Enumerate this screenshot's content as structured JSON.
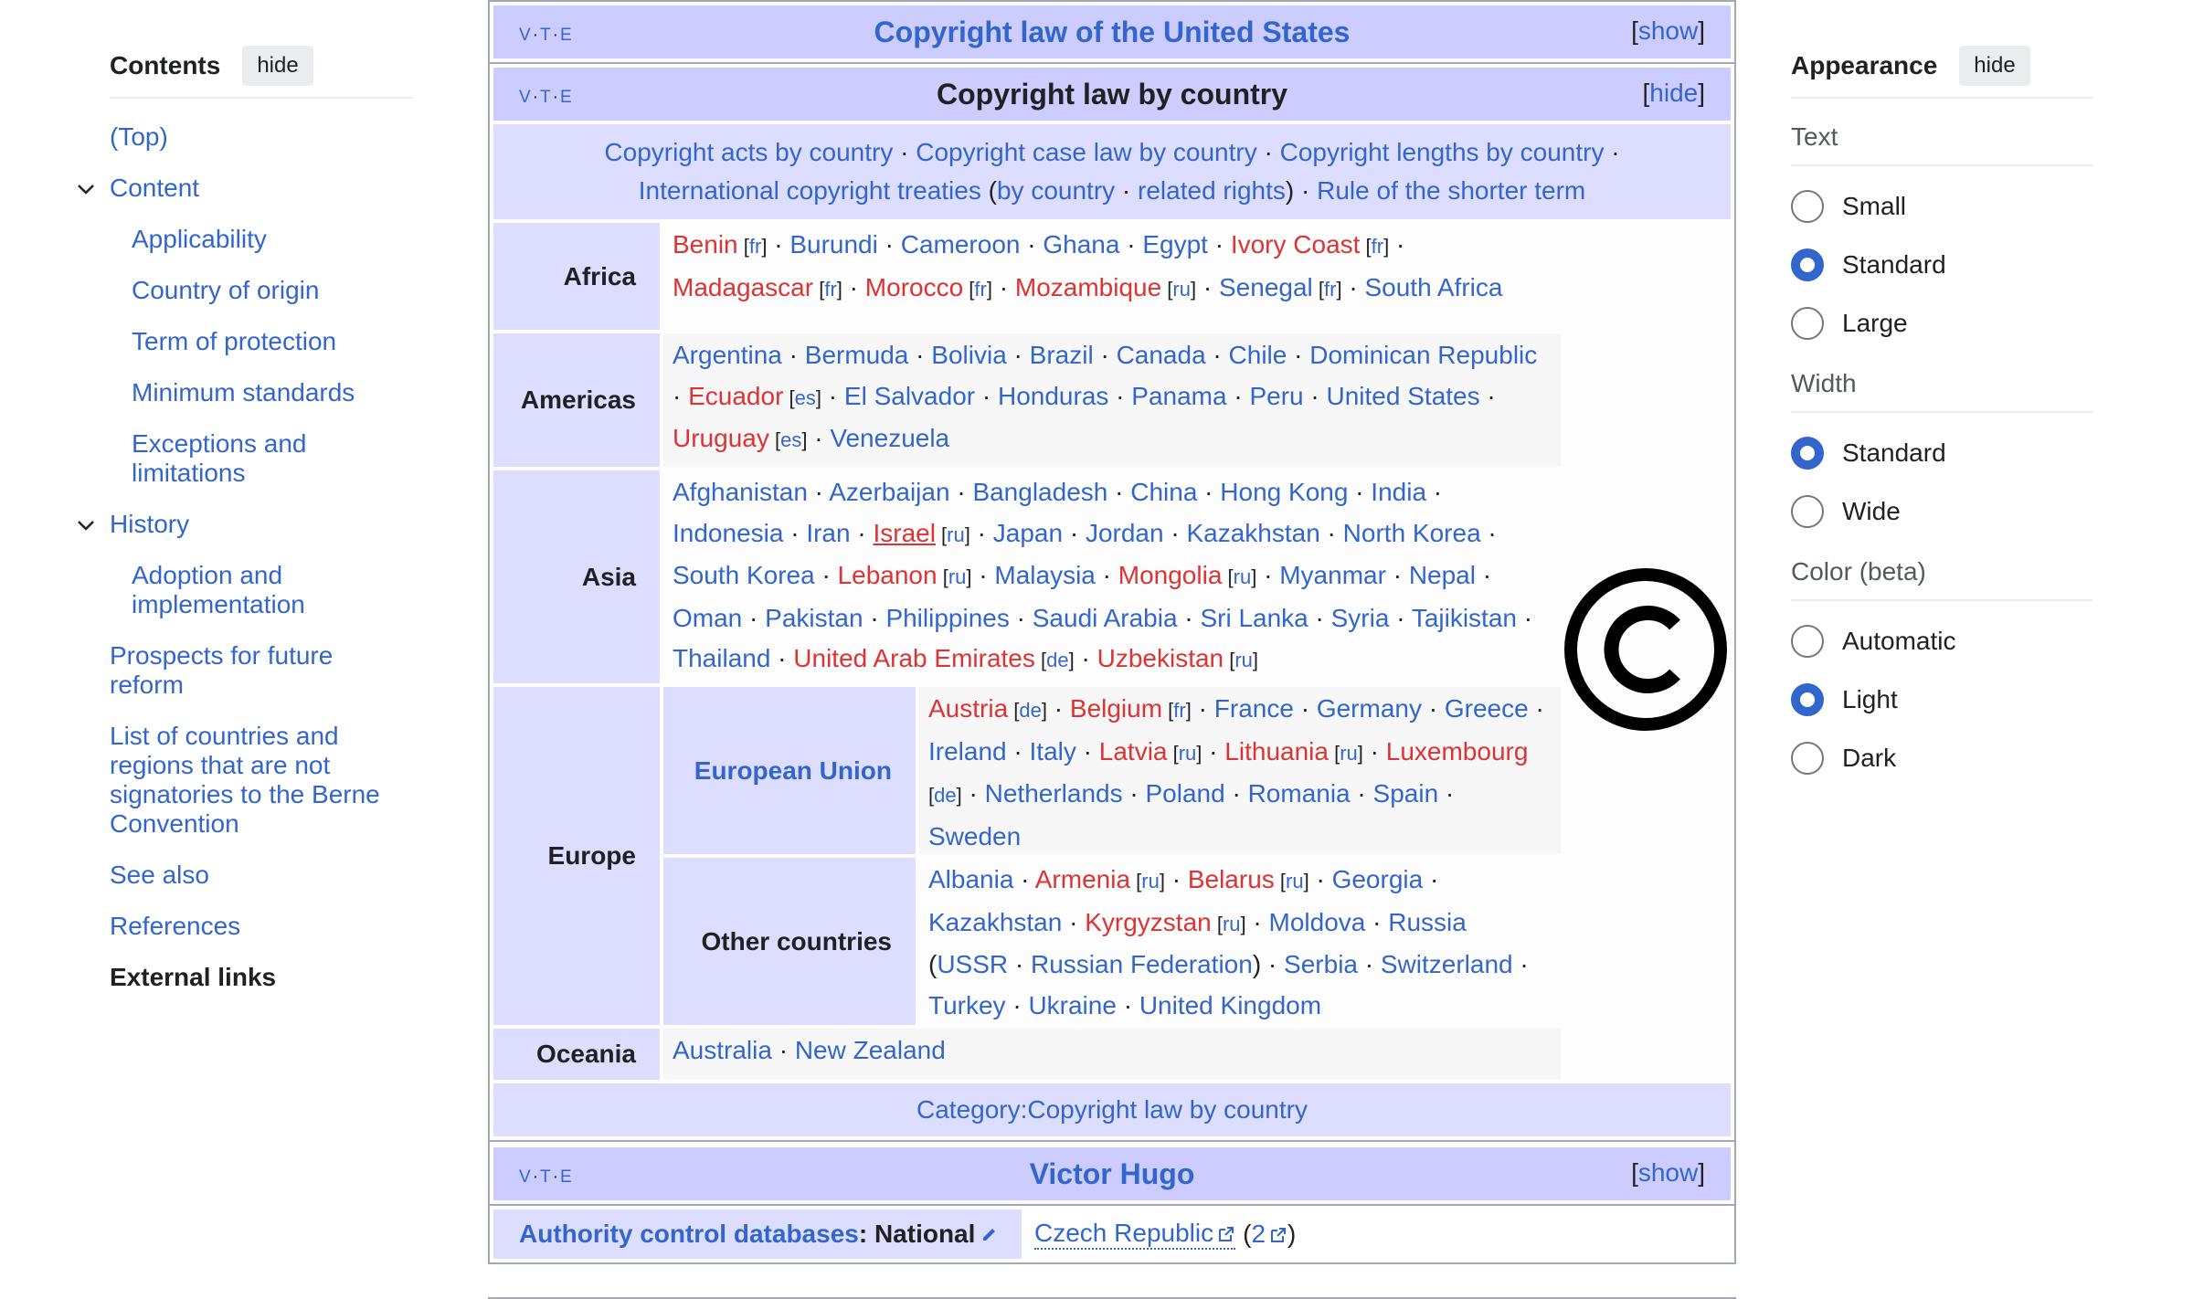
{
  "toc": {
    "title": "Contents",
    "hide_label": "hide",
    "items": [
      {
        "label": "(Top)",
        "level": 1
      },
      {
        "label": "Content",
        "level": 1,
        "expanded": true
      },
      {
        "label": "Applicability",
        "level": 2
      },
      {
        "label": "Country of origin",
        "level": 2
      },
      {
        "label": "Term of protection",
        "level": 2
      },
      {
        "label": "Minimum standards",
        "level": 2
      },
      {
        "label": "Exceptions and limitations",
        "level": 2
      },
      {
        "label": "History",
        "level": 1,
        "expanded": true
      },
      {
        "label": "Adoption and implementation",
        "level": 2
      },
      {
        "label": "Prospects for future reform",
        "level": 1
      },
      {
        "label": "List of countries and regions that are not signatories to the Berne Convention",
        "level": 1
      },
      {
        "label": "See also",
        "level": 1
      },
      {
        "label": "References",
        "level": 1
      },
      {
        "label": "External links",
        "level": 1,
        "active": true
      }
    ]
  },
  "appearance": {
    "title": "Appearance",
    "hide_label": "hide",
    "text_heading": "Text",
    "text_options": [
      "Small",
      "Standard",
      "Large"
    ],
    "text_selected": "Standard",
    "width_heading": "Width",
    "width_options": [
      "Standard",
      "Wide"
    ],
    "width_selected": "Standard",
    "color_heading": "Color (beta)",
    "color_options": [
      "Automatic",
      "Light",
      "Dark"
    ],
    "color_selected": "Light"
  },
  "navbox_top": {
    "vte": [
      "V",
      "T",
      "E"
    ],
    "title": "Copyright law of the United States",
    "toggle": "show"
  },
  "navbox_main": {
    "vte": [
      "V",
      "T",
      "E"
    ],
    "title": "Copyright law by country",
    "toggle": "hide",
    "above": {
      "acts": "Copyright acts by country",
      "case_law": "Copyright case law by country",
      "lengths": "Copyright lengths by country",
      "treaties": "International copyright treaties",
      "by_country": "by country",
      "related": "related rights",
      "shorter": "Rule of the shorter term"
    },
    "groups": {
      "africa": {
        "label": "Africa",
        "items": [
          {
            "name": "Benin",
            "red": true,
            "lang": "fr"
          },
          {
            "name": "Burundi"
          },
          {
            "name": "Cameroon"
          },
          {
            "name": "Ghana"
          },
          {
            "name": "Egypt"
          },
          {
            "name": "Ivory Coast",
            "red": true,
            "lang": "fr"
          },
          {
            "name": "Madagascar",
            "red": true,
            "lang": "fr"
          },
          {
            "name": "Morocco",
            "red": true,
            "lang": "fr"
          },
          {
            "name": "Mozambique",
            "red": true,
            "lang": "ru"
          },
          {
            "name": "Senegal",
            "lang": "fr"
          },
          {
            "name": "South Africa"
          }
        ]
      },
      "americas": {
        "label": "Americas",
        "items": [
          {
            "name": "Argentina"
          },
          {
            "name": "Bermuda"
          },
          {
            "name": "Bolivia"
          },
          {
            "name": "Brazil"
          },
          {
            "name": "Canada"
          },
          {
            "name": "Chile"
          },
          {
            "name": "Dominican Republic"
          },
          {
            "name": "Ecuador",
            "red": true,
            "lang": "es"
          },
          {
            "name": "El Salvador"
          },
          {
            "name": "Honduras"
          },
          {
            "name": "Panama"
          },
          {
            "name": "Peru"
          },
          {
            "name": "United States"
          },
          {
            "name": "Uruguay",
            "red": true,
            "lang": "es"
          },
          {
            "name": "Venezuela"
          }
        ]
      },
      "asia": {
        "label": "Asia",
        "items": [
          {
            "name": "Afghanistan"
          },
          {
            "name": "Azerbaijan"
          },
          {
            "name": "Bangladesh"
          },
          {
            "name": "China"
          },
          {
            "name": "Hong Kong"
          },
          {
            "name": "India"
          },
          {
            "name": "Indonesia"
          },
          {
            "name": "Iran"
          },
          {
            "name": "Israel",
            "red": true,
            "underline": true,
            "lang": "ru"
          },
          {
            "name": "Japan"
          },
          {
            "name": "Jordan"
          },
          {
            "name": "Kazakhstan"
          },
          {
            "name": "North Korea"
          },
          {
            "name": "South Korea"
          },
          {
            "name": "Lebanon",
            "red": true,
            "lang": "ru"
          },
          {
            "name": "Malaysia"
          },
          {
            "name": "Mongolia",
            "red": true,
            "lang": "ru"
          },
          {
            "name": "Myanmar"
          },
          {
            "name": "Nepal"
          },
          {
            "name": "Oman"
          },
          {
            "name": "Pakistan"
          },
          {
            "name": "Philippines"
          },
          {
            "name": "Saudi Arabia"
          },
          {
            "name": "Sri Lanka"
          },
          {
            "name": "Syria"
          },
          {
            "name": "Tajikistan"
          },
          {
            "name": "Thailand"
          },
          {
            "name": "United Arab Emirates",
            "red": true,
            "lang": "de"
          },
          {
            "name": "Uzbekistan",
            "red": true,
            "lang": "ru"
          }
        ]
      },
      "europe": {
        "label": "Europe",
        "eu": {
          "label": "European Union",
          "items": [
            {
              "name": "Austria",
              "red": true,
              "lang": "de"
            },
            {
              "name": "Belgium",
              "red": true,
              "lang": "fr"
            },
            {
              "name": "France"
            },
            {
              "name": "Germany"
            },
            {
              "name": "Greece"
            },
            {
              "name": "Ireland"
            },
            {
              "name": "Italy"
            },
            {
              "name": "Latvia",
              "red": true,
              "lang": "ru"
            },
            {
              "name": "Lithuania",
              "red": true,
              "lang": "ru"
            },
            {
              "name": "Luxembourg",
              "red": true,
              "lang": "de"
            },
            {
              "name": "Netherlands"
            },
            {
              "name": "Poland"
            },
            {
              "name": "Romania"
            },
            {
              "name": "Spain"
            },
            {
              "name": "Sweden"
            }
          ]
        },
        "other": {
          "label": "Other countries",
          "items": [
            {
              "name": "Albania"
            },
            {
              "name": "Armenia",
              "red": true,
              "lang": "ru"
            },
            {
              "name": "Belarus",
              "red": true,
              "lang": "ru"
            },
            {
              "name": "Georgia"
            },
            {
              "name": "Kazakhstan"
            },
            {
              "name": "Kyrgyzstan",
              "red": true,
              "lang": "ru"
            },
            {
              "name": "Moldova"
            },
            {
              "name": "Russia",
              "children": [
                "USSR",
                "Russian Federation"
              ]
            },
            {
              "name": "Serbia"
            },
            {
              "name": "Switzerland"
            },
            {
              "name": "Turkey"
            },
            {
              "name": "Ukraine"
            },
            {
              "name": "United Kingdom"
            }
          ]
        }
      },
      "oceania": {
        "label": "Oceania",
        "items": [
          {
            "name": "Australia"
          },
          {
            "name": "New Zealand"
          }
        ]
      }
    },
    "below": "Category:Copyright law by country"
  },
  "navbox_hugo": {
    "vte": [
      "V",
      "T",
      "E"
    ],
    "title": "Victor Hugo",
    "toggle": "show"
  },
  "authority": {
    "label_link": "Authority control databases",
    "label_rest": ": National",
    "country": "Czech Republic",
    "second": "2"
  },
  "colors": {
    "link": "#3366cc",
    "redlink": "#dd3333",
    "navbox_title_bg": "#ccccff",
    "navbox_group_bg": "#ddddff",
    "radio_selected": "#3366cc"
  }
}
